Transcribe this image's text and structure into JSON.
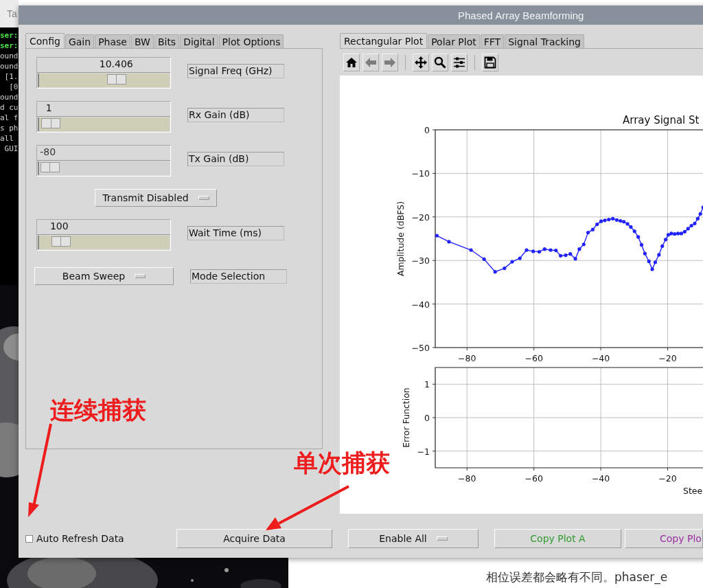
{
  "desktop": {
    "terminal_tab": "Ta",
    "terminal_lines": [
      {
        "text": "ser:",
        "kind": "prompt"
      },
      {
        "text": "ser:",
        "kind": "prompt"
      },
      {
        "text": "ound",
        "kind": "output"
      },
      {
        "text": "ound",
        "kind": "output"
      },
      {
        "text": " [1.",
        "kind": "output"
      },
      {
        "text": "  [0",
        "kind": "output"
      },
      {
        "text": "ound",
        "kind": "output"
      },
      {
        "text": "d cu",
        "kind": "output"
      },
      {
        "text": "al f",
        "kind": "output"
      },
      {
        "text": "s ph",
        "kind": "output"
      },
      {
        "text": "all",
        "kind": "output"
      },
      {
        "text": " GUI",
        "kind": "output"
      }
    ],
    "web_text": "相位误差都会略有不同。phaser_e"
  },
  "window": {
    "title": "Phased Array Beamforming"
  },
  "config_tabs": [
    {
      "label": "Config",
      "selected": true
    },
    {
      "label": "Gain",
      "selected": false
    },
    {
      "label": "Phase",
      "selected": false
    },
    {
      "label": "BW",
      "selected": false
    },
    {
      "label": "Bits",
      "selected": false
    },
    {
      "label": "Digital",
      "selected": false
    },
    {
      "label": "Plot Options",
      "selected": false
    }
  ],
  "controls": [
    {
      "kind": "slider",
      "value": "10.406",
      "level": 0.61,
      "disabled": false,
      "label": "Signal Freq (GHz)"
    },
    {
      "kind": "slider",
      "value": "1",
      "level": 0.02,
      "disabled": false,
      "label": "Rx Gain (dB)"
    },
    {
      "kind": "slider",
      "value": "-80",
      "level": 0.01,
      "disabled": true,
      "label": "Tx Gain (dB)"
    },
    {
      "kind": "dropdown",
      "value": "Transmit Disabled"
    },
    {
      "kind": "slider",
      "value": "100",
      "level": 0.11,
      "disabled": false,
      "label": "Wait Time (ms)"
    },
    {
      "kind": "dropdown",
      "value": "Beam Sweep",
      "label": "Mode Selection"
    }
  ],
  "plot_tabs": [
    {
      "label": "Rectangular Plot",
      "selected": true
    },
    {
      "label": "Polar Plot",
      "selected": false
    },
    {
      "label": "FFT",
      "selected": false
    },
    {
      "label": "Signal Tracking",
      "selected": false
    }
  ],
  "toolbar": [
    {
      "kind": "home",
      "disabled": false
    },
    {
      "kind": "back",
      "disabled": true
    },
    {
      "kind": "forward",
      "disabled": true
    },
    {
      "kind": "pan",
      "disabled": false
    },
    {
      "kind": "zoom",
      "disabled": false
    },
    {
      "kind": "configure",
      "disabled": false
    },
    {
      "kind": "save",
      "disabled": false
    }
  ],
  "plots": [
    {
      "chart_data": {
        "type": "line",
        "title": "Array Signal St",
        "ylabel": "Amplitude (dBFS)",
        "x": [
          -89,
          -85.4,
          -78.8,
          -74.9,
          -71.6,
          -68.8,
          -66.5,
          -64.2,
          -62.2,
          -60.2,
          -58.4,
          -56.8,
          -55.0,
          -53.4,
          -52.0,
          -50.5,
          -49.1,
          -47.6,
          -46.4,
          -45.1,
          -43.8,
          -42.4,
          -41.1,
          -39.9,
          -38.8,
          -37.6,
          -36.4,
          -35.2,
          -34.1,
          -33.1,
          -32.0,
          -31.0,
          -29.9,
          -28.8,
          -27.8,
          -26.8,
          -25.6,
          -24.6,
          -23.7,
          -22.6,
          -21.6,
          -20.6,
          -19.8,
          -18.9,
          -17.9,
          -16.9,
          -15.9,
          -14.9,
          -13.9,
          -12.9,
          -11.9,
          -11.0,
          -10.2,
          -9.4
        ],
        "grid": true,
        "series": [
          {
            "color": "#2222ff",
            "values": [
              -24.3,
              -25.7,
              -27.6,
              -29.7,
              -32.6,
              -31.8,
              -30.3,
              -29.5,
              -27.6,
              -27.9,
              -28.0,
              -27.4,
              -27.6,
              -27.7,
              -28.9,
              -28.8,
              -28.5,
              -29.6,
              -27.4,
              -26.3,
              -23.6,
              -22.9,
              -21.7,
              -21.0,
              -20.8,
              -20.6,
              -20.4,
              -20.7,
              -20.9,
              -21.1,
              -21.6,
              -22.3,
              -23.3,
              -24.6,
              -26.4,
              -28.4,
              -30.2,
              -32.0,
              -30.4,
              -28.7,
              -26.7,
              -25.2,
              -24.1,
              -23.8,
              -23.9,
              -23.8,
              -23.8,
              -23.4,
              -22.7,
              -22.0,
              -21.5,
              -20.4,
              -19.3,
              -17.8
            ]
          }
        ],
        "xlim": [
          -89.5,
          -9.3
        ],
        "ylim": [
          -50,
          0
        ],
        "xticks": [
          {
            "value": -80,
            "label": "−80"
          },
          {
            "value": -60,
            "label": "−60"
          },
          {
            "value": -40,
            "label": "−40"
          },
          {
            "value": -20,
            "label": "−20"
          }
        ],
        "yticks": [
          {
            "value": 0,
            "label": "0"
          },
          {
            "value": -10,
            "label": "−10"
          },
          {
            "value": -20,
            "label": "−20"
          },
          {
            "value": -30,
            "label": "−30"
          },
          {
            "value": -40,
            "label": "−40"
          },
          {
            "value": -50,
            "label": "−50"
          }
        ]
      }
    },
    {
      "chart_data": {
        "type": "line",
        "grid": true,
        "ylabel": "Error Function",
        "xlabel": "Stee",
        "xlim": [
          -89.5,
          -9.3
        ],
        "ylim": [
          -1.5,
          1.5
        ],
        "xticks": [
          {
            "value": -80,
            "label": "−80"
          },
          {
            "value": -60,
            "label": "−60"
          },
          {
            "value": -40,
            "label": "−40"
          },
          {
            "value": -20,
            "label": "−20"
          }
        ],
        "yticks": [
          {
            "value": 1,
            "label": "1"
          },
          {
            "value": 0,
            "label": "0"
          },
          {
            "value": -1,
            "label": "−1"
          }
        ]
      }
    }
  ],
  "bottom": {
    "auto_refresh": {
      "label": "Auto Refresh Data",
      "checked": false
    },
    "acquire_button": "Acquire Data",
    "enable_dropdown": "Enable All",
    "copy_buttons": [
      {
        "label": "Copy Plot A",
        "color": "#2e9a2e"
      },
      {
        "label": "Copy Plo",
        "color": "#9a2ea0"
      }
    ]
  },
  "annotations": [
    {
      "text": "连续捕获"
    },
    {
      "text": "单次捕获"
    }
  ]
}
